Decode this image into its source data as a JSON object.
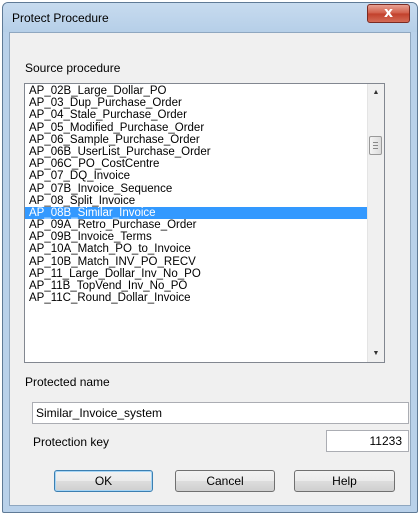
{
  "window": {
    "title": "Protect Procedure",
    "close_glyph": "x"
  },
  "source": {
    "label": "Source procedure",
    "items": [
      "AP_02B_Large_Dollar_PO",
      "AP_03_Dup_Purchase_Order",
      "AP_04_Stale_Purchase_Order",
      "AP_05_Modified_Purchase_Order",
      "AP_06_Sample_Purchase_Order",
      "AP_06B_UserList_Purchase_Order",
      "AP_06C_PO_CostCentre",
      "AP_07_DQ_Invoice",
      "AP_07B_Invoice_Sequence",
      "AP_08_Split_Invoice",
      "AP_08B_Similar_Invoice",
      "AP_09A_Retro_Purchase_Order",
      "AP_09B_Invoice_Terms",
      "AP_10A_Match_PO_to_Invoice",
      "AP_10B_Match_INV_PO_RECV",
      "AP_11_Large_Dollar_Inv_No_PO",
      "AP_11B_TopVend_Inv_No_PO",
      "AP_11C_Round_Dollar_Invoice"
    ],
    "selected_index": 10
  },
  "protected_name": {
    "label": "Protected name",
    "value": "Similar_Invoice_system"
  },
  "protection_key": {
    "label": "Protection key",
    "value": "11233"
  },
  "buttons": {
    "ok": "OK",
    "cancel": "Cancel",
    "help": "Help"
  }
}
